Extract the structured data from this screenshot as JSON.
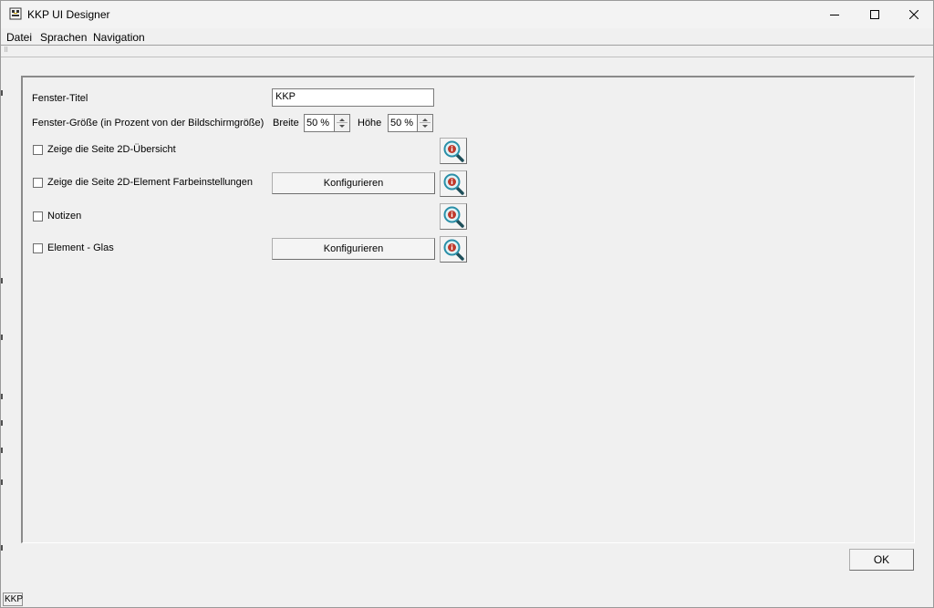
{
  "window": {
    "title": "KKP UI Designer",
    "icons": {
      "app": "app-logo-icon",
      "minimize": "minimize-icon",
      "maximize": "maximize-icon",
      "close": "close-icon"
    }
  },
  "menu": {
    "items": [
      {
        "label": "Datei"
      },
      {
        "label": "Sprachen"
      },
      {
        "label": "Navigation"
      }
    ]
  },
  "form": {
    "title_label": "Fenster-Titel",
    "title_value": "KKP",
    "size_label": "Fenster-Größe (in Prozent von der Bildschirmgröße)",
    "width_label": "Breite",
    "width_value": "50 %",
    "height_label": "Höhe",
    "height_value": "50 %",
    "options": [
      {
        "label": "Zeige die Seite 2D-Übersicht",
        "checked": false,
        "configure": ""
      },
      {
        "label": "Zeige die Seite 2D-Element Farbeinstellungen",
        "checked": false,
        "configure": "Konfigurieren"
      },
      {
        "label": "Notizen",
        "checked": false,
        "configure": ""
      },
      {
        "label": "Element - Glas",
        "checked": false,
        "configure": "Konfigurieren"
      }
    ],
    "info_icon": "info-magnifier-icon"
  },
  "footer": {
    "ok_label": "OK"
  },
  "statusbar": {
    "text": "KKP"
  },
  "colors": {
    "background": "#f0f0f0",
    "info_accent": "#2a8fa8",
    "info_badge": "#c0392b"
  }
}
